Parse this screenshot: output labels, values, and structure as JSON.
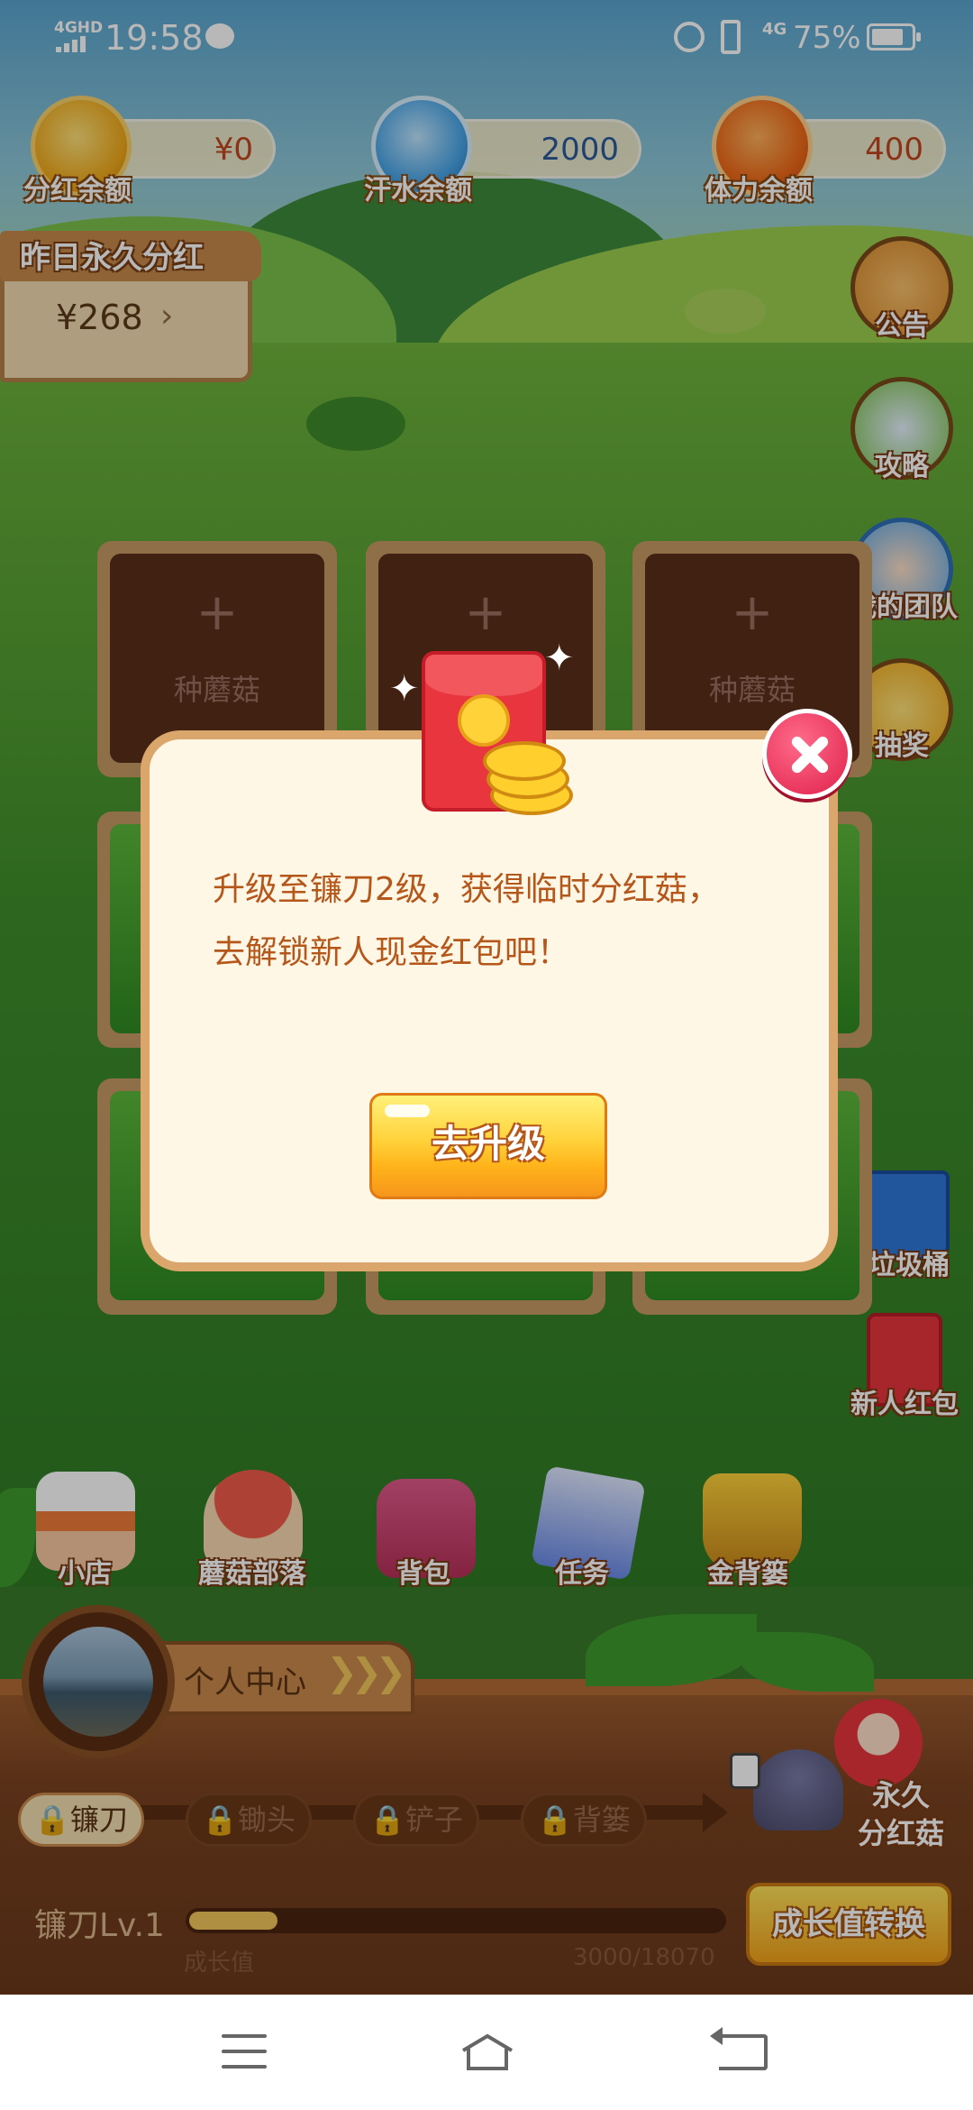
{
  "status_bar": {
    "network": "4GHD",
    "time": "19:58",
    "signal_4g": "4G",
    "battery": "75%"
  },
  "balances": {
    "dividend": {
      "label": "分红余额",
      "value": "¥0",
      "icon": "mushroom-coin-icon"
    },
    "sweat": {
      "label": "汗水余额",
      "value": "2000",
      "icon": "water-drop-icon"
    },
    "stamina": {
      "label": "体力余额",
      "value": "400",
      "icon": "battery-icon"
    }
  },
  "yesterday": {
    "title": "昨日永久分红",
    "amount": "¥268",
    "arrow": "›"
  },
  "side_buttons": [
    {
      "label": "公告",
      "icon": "megaphone-icon"
    },
    {
      "label": "攻略",
      "icon": "guide-book-icon"
    },
    {
      "label": "我的团队",
      "icon": "team-avatar-icon"
    },
    {
      "label": "抽奖",
      "icon": "lottery-wheel-icon"
    },
    {
      "label": "垃圾桶",
      "icon": "trash-bin-icon"
    },
    {
      "label": "新人红包",
      "icon": "red-packet-icon"
    }
  ],
  "plots": {
    "plus": "+",
    "plant_label": "种蘑菇"
  },
  "bottom_menu": [
    {
      "label": "小店",
      "icon": "shop-icon"
    },
    {
      "label": "蘑菇部落",
      "icon": "mushroom-house-icon"
    },
    {
      "label": "背包",
      "icon": "backpack-icon"
    },
    {
      "label": "任务",
      "icon": "task-clipboard-icon"
    },
    {
      "label": "金背篓",
      "icon": "golden-basket-icon"
    }
  ],
  "personal_center": {
    "label": "个人中心",
    "chevrons": "❯❯❯"
  },
  "tools": [
    {
      "label": "镰刀",
      "locked": false
    },
    {
      "label": "锄头",
      "locked": true
    },
    {
      "label": "铲子",
      "locked": true
    },
    {
      "label": "背篓",
      "locked": true
    }
  ],
  "permanent_mushroom": {
    "label_line1": "永久",
    "label_line2": "分红菇"
  },
  "level": {
    "label": "镰刀Lv.1",
    "growth_label": "成长值",
    "growth_value": "3000/18070",
    "progress": 0.166
  },
  "convert_button": "成长值转换",
  "modal": {
    "line1": "升级至镰刀2级，获得临时分红菇，",
    "line2": "去解锁新人现金红包吧！",
    "button": "去升级"
  },
  "colors": {
    "modal_text": "#b5561a",
    "close_button": "#e0204a",
    "button_yellow": "#ffd23a"
  }
}
